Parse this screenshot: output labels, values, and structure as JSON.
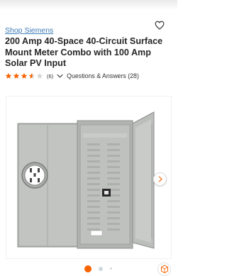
{
  "product": {
    "brand_link": "Shop Siemens",
    "title": "200 Amp 40-Space 40-Circuit Surface Mount Meter Combo with 100 Amp Solar PV Input"
  },
  "rating": {
    "value": 3.5,
    "max": 5,
    "count_text": "(6)",
    "qa_label": "Questions & Answers (28)"
  },
  "gallery": {
    "active_index": 1,
    "dot_count": 3
  },
  "icons": {
    "favorite": "heart-outline-icon",
    "expand": "chevron-down-icon",
    "next": "chevron-right-icon",
    "view_in_room": "ar-cube-icon"
  },
  "colors": {
    "accent": "#f96302",
    "link": "#3e7bb6",
    "star": "#f96302",
    "inactive_dot": "#cfd8df"
  }
}
